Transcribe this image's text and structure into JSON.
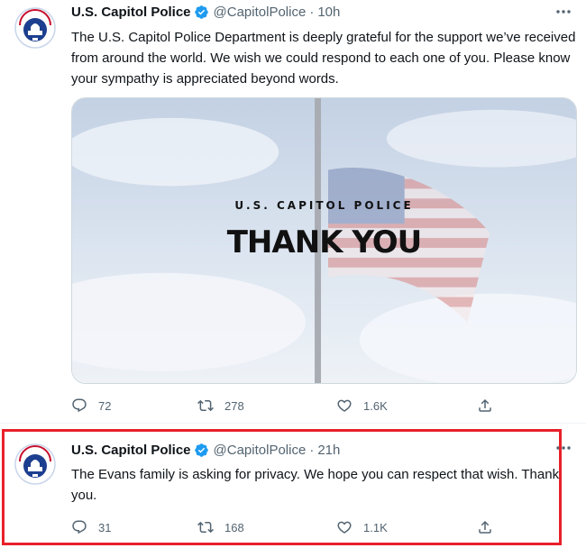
{
  "tweets": [
    {
      "author": "U.S. Capitol Police",
      "handle": "@CapitolPolice",
      "separator": "·",
      "time": "10h",
      "text": "The U.S. Capitol Police Department is deeply grateful for the support we’ve received from around the world. We wish we could respond to each one of you. Please know your sympathy is appreciated beyond words.",
      "media": {
        "kicker": "U.S. CAPITOL POLICE",
        "headline": "THANK YOU"
      },
      "replies": "72",
      "retweets": "278",
      "likes": "1.6K"
    },
    {
      "author": "U.S. Capitol Police",
      "handle": "@CapitolPolice",
      "separator": "·",
      "time": "21h",
      "text": "The Evans family is asking for privacy. We hope you can respect that wish. Thank you.",
      "replies": "31",
      "retweets": "168",
      "likes": "1.1K"
    }
  ],
  "colors": {
    "verified": "#1d9bf0",
    "muted": "#536471",
    "highlight": "#e8202a"
  },
  "icons": [
    "verified-badge-icon",
    "more-icon",
    "reply-icon",
    "retweet-icon",
    "like-icon",
    "share-icon"
  ]
}
